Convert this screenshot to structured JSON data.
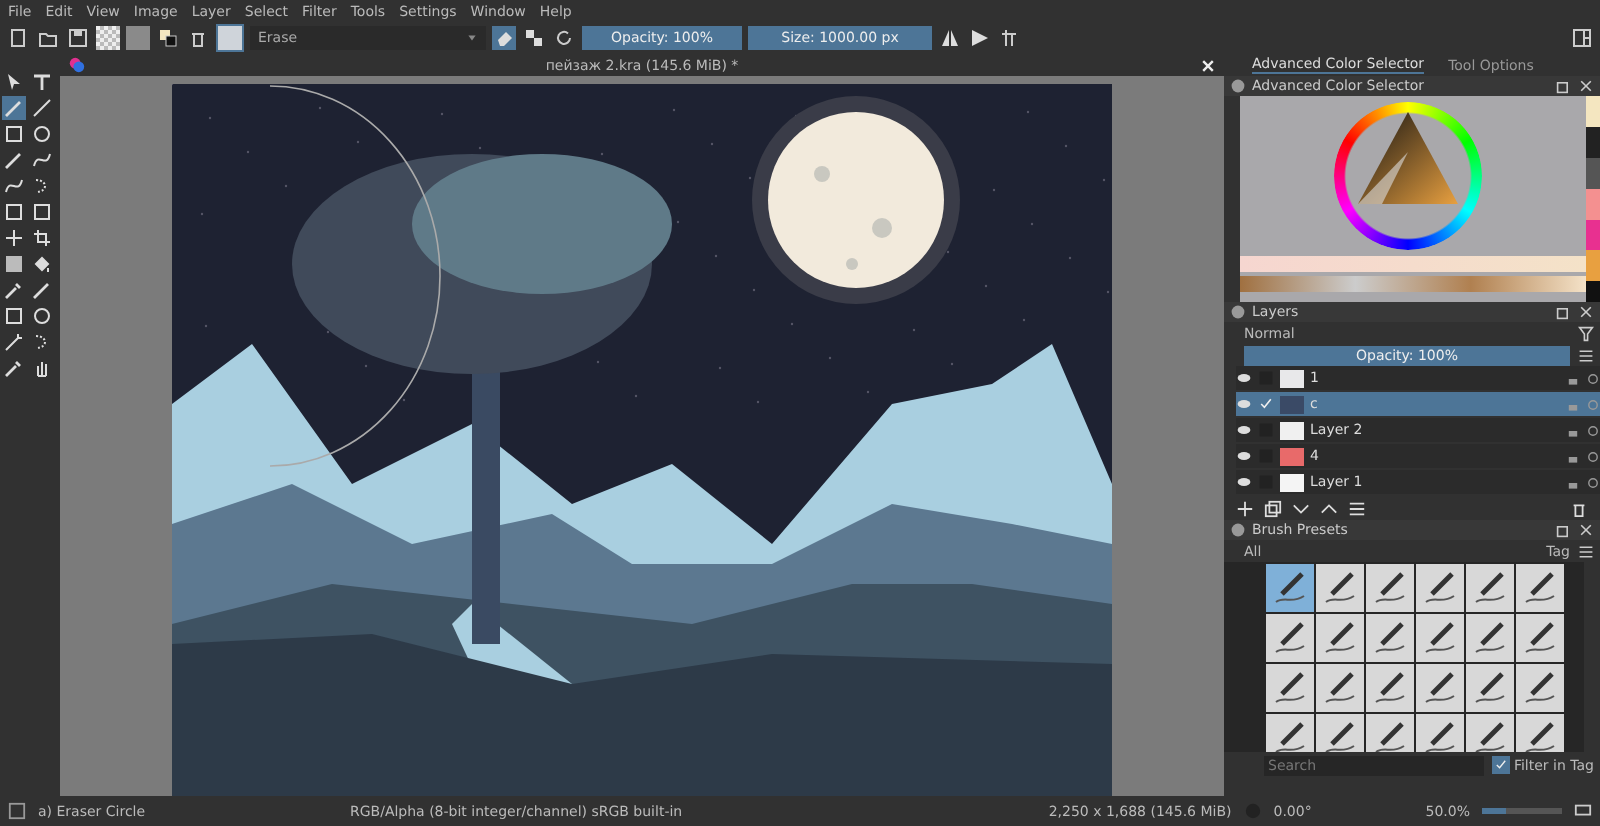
{
  "menu": [
    "File",
    "Edit",
    "View",
    "Image",
    "Layer",
    "Select",
    "Filter",
    "Tools",
    "Settings",
    "Window",
    "Help"
  ],
  "toolbar": {
    "brush_preset": "Erase",
    "opacity": {
      "label": "Opacity: 100%",
      "level": 1
    },
    "size": {
      "label": "Size: 1000.00 px",
      "level": 1
    }
  },
  "document_tab": {
    "title": "пейзаж 2.kra (145.6 MiB) *"
  },
  "docker_tabs": [
    {
      "label": "Advanced Color Selector",
      "selected": true
    },
    {
      "label": "Tool Options",
      "selected": false
    }
  ],
  "color_selector": {
    "title": "Advanced Color Selector"
  },
  "layers": {
    "title": "Layers",
    "blend_mode": "Normal",
    "opacity": {
      "label": "Opacity:  100%",
      "level": 1
    },
    "items": [
      {
        "name": "1",
        "selected": false,
        "active": false
      },
      {
        "name": "c",
        "selected": true,
        "active": true
      },
      {
        "name": "Layer 2",
        "selected": false,
        "active": false
      },
      {
        "name": "4",
        "selected": false,
        "active": false
      },
      {
        "name": "Layer 1",
        "selected": false,
        "active": false
      }
    ]
  },
  "brush_presets": {
    "title": "Brush Presets",
    "filter": "All",
    "tag": "Tag",
    "search_placeholder": "Search",
    "filter_in_tag": {
      "label": "Filter in Tag",
      "checked": true
    },
    "presets": [
      {
        "selected": true
      },
      {
        "selected": false
      },
      {
        "selected": false
      },
      {
        "selected": false
      },
      {
        "selected": false
      },
      {
        "selected": false
      },
      {
        "selected": false
      },
      {
        "selected": false
      },
      {
        "selected": false
      },
      {
        "selected": false
      },
      {
        "selected": false
      },
      {
        "selected": false
      },
      {
        "selected": false
      },
      {
        "selected": false
      },
      {
        "selected": false
      },
      {
        "selected": false
      },
      {
        "selected": false
      },
      {
        "selected": false
      },
      {
        "selected": false
      },
      {
        "selected": false
      },
      {
        "selected": false
      },
      {
        "selected": false
      },
      {
        "selected": false
      },
      {
        "selected": false
      }
    ]
  },
  "status_bar": {
    "tool": "a) Eraser Circle",
    "color_space": "RGB/Alpha (8-bit integer/channel)  sRGB built-in",
    "image_size": "2,250 x 1,688 (145.6 MiB)",
    "rotation": "0.00°",
    "zoom": "50.0%",
    "zoom_slider": {
      "level": 0.3
    }
  }
}
